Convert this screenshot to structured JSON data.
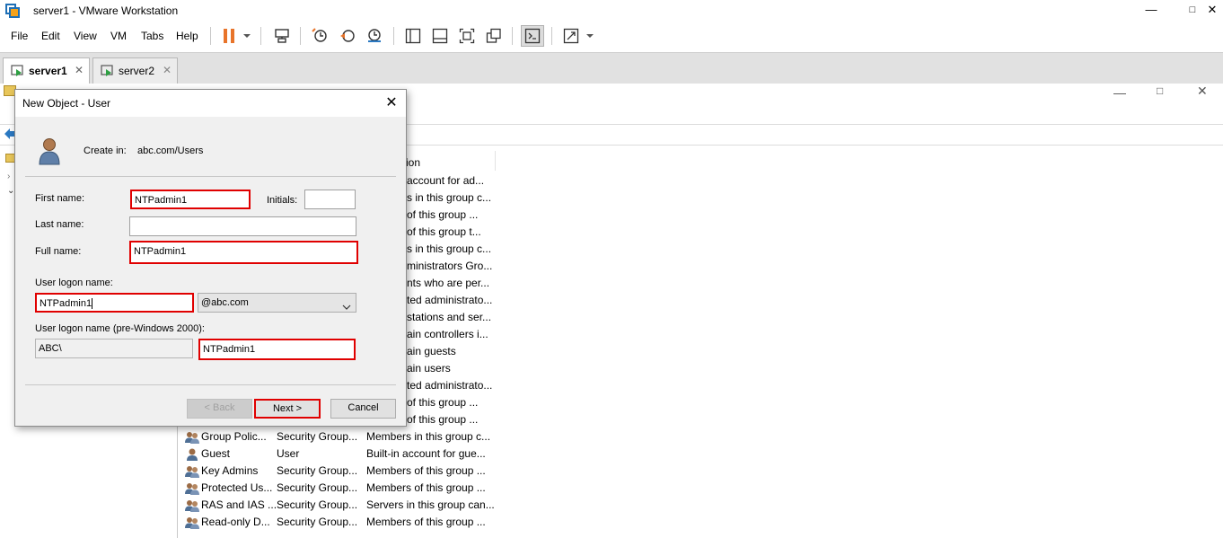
{
  "app": {
    "title": "server1 - VMware Workstation",
    "window_min": "—",
    "window_max": "□",
    "window_close": "✕"
  },
  "menu": [
    "File",
    "Edit",
    "View",
    "VM",
    "Tabs",
    "Help"
  ],
  "tabs": [
    {
      "label": "server1",
      "active": true,
      "close": "✕"
    },
    {
      "label": "server2",
      "active": false,
      "close": "✕"
    }
  ],
  "background": {
    "column_header_partial": "ion",
    "partial_rows": [
      "account for ad...",
      "s in this group c...",
      "of this group ...",
      "of this group t...",
      "s in this group c...",
      "ministrators Gro...",
      "nts who are per...",
      "ted administrato...",
      "stations and ser...",
      "ain controllers i...",
      "ain guests",
      "ain users",
      "ted administrato...",
      "of this group ...",
      "of this group ..."
    ],
    "rows": [
      {
        "name": "Group Polic...",
        "type": "Security Group...",
        "description": "Members in this group c...",
        "icon": "group-icon"
      },
      {
        "name": "Guest",
        "type": "User",
        "description": "Built-in account for gue...",
        "icon": "user-icon"
      },
      {
        "name": "Key Admins",
        "type": "Security Group...",
        "description": "Members of this group ...",
        "icon": "group-icon"
      },
      {
        "name": "Protected Us...",
        "type": "Security Group...",
        "description": "Members of this group ...",
        "icon": "group-icon"
      },
      {
        "name": "RAS and IAS ...",
        "type": "Security Group...",
        "description": "Servers in this group can...",
        "icon": "group-icon"
      },
      {
        "name": "Read-only D...",
        "type": "Security Group...",
        "description": "Members of this group ...",
        "icon": "group-icon"
      }
    ]
  },
  "dialog": {
    "title": "New Object - User",
    "close": "✕",
    "create_in_label": "Create in:",
    "create_in_value": "abc.com/Users",
    "first_name_label": "First name:",
    "first_name_value": "NTPadmin1",
    "initials_label": "Initials:",
    "initials_value": "",
    "last_name_label": "Last name:",
    "last_name_value": "",
    "full_name_label": "Full name:",
    "full_name_value": "NTPadmin1",
    "logon_label": "User logon name:",
    "logon_value": "NTPadmin1",
    "domain_value": "@abc.com",
    "prewin_label": "User logon name (pre-Windows 2000):",
    "prewin_domain": "ABC\\",
    "prewin_value": "NTPadmin1",
    "back_label": "< Back",
    "next_label": "Next >",
    "cancel_label": "Cancel"
  },
  "colors": {
    "highlight": "#e00000",
    "pause": "#e8742a",
    "accent": "#2b79c2"
  }
}
